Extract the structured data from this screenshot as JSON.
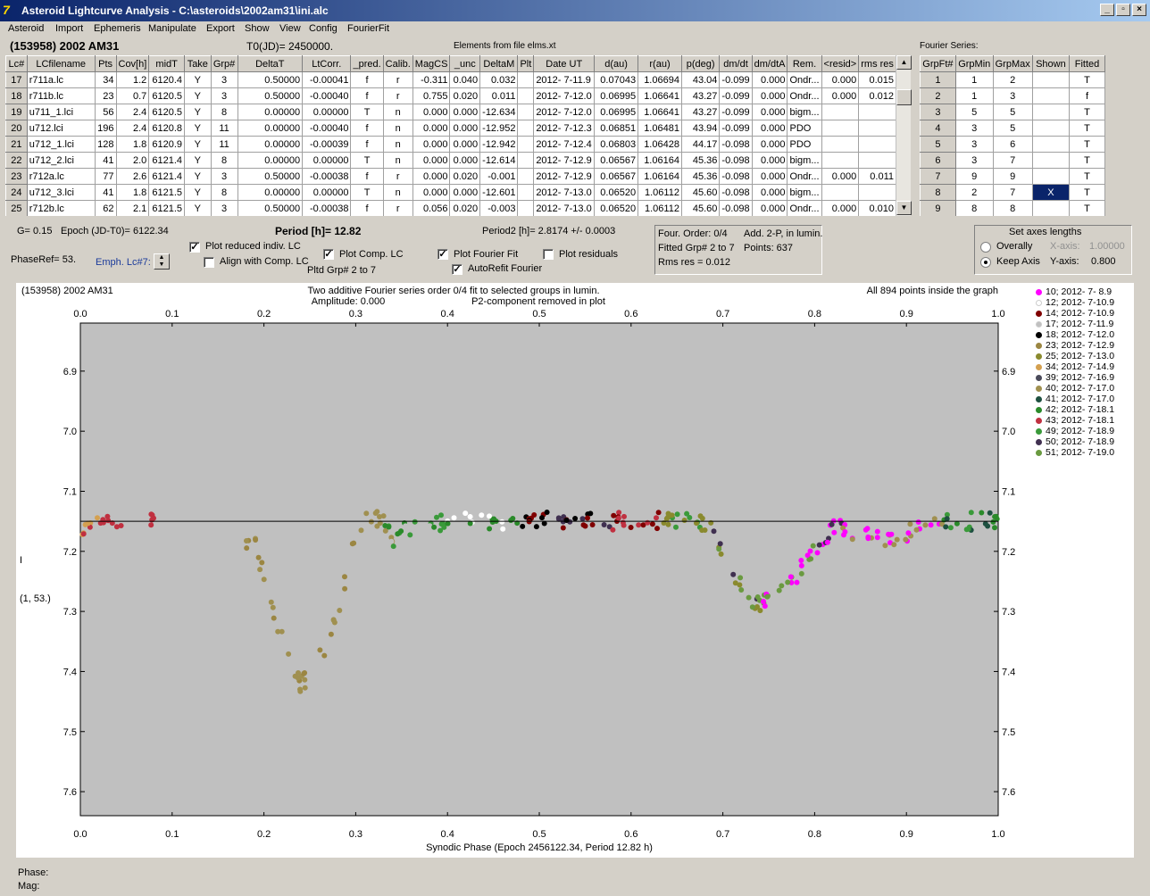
{
  "window": {
    "title": "Asteroid Lightcurve Analysis - C:\\asteroids\\2002am31\\ini.alc"
  },
  "menu": [
    "Asteroid",
    "Import",
    "Ephemeris",
    "Manipulate",
    "Export",
    "Show",
    "View",
    "Config",
    "FourierFit"
  ],
  "header": {
    "object": "(153958) 2002 AM31",
    "t0": "T0(JD)= 2450000.",
    "elements": "Elements from file elms.xt",
    "fourier_series": "Fourier Series:"
  },
  "lc_table": {
    "columns": [
      "Lc#",
      "LCfilename",
      "Pts",
      "Cov[h]",
      "midT",
      "Take",
      "Grp#",
      "DeltaT",
      "LtCorr.",
      "_pred.",
      "Calib.",
      "MagCS",
      "_unc",
      "DeltaM",
      "Plt",
      "Date UT",
      "d(au)",
      "r(au)",
      "p(deg)",
      "dm/dt",
      "dm/dtA",
      "Rem.",
      "<resid>",
      "rms res"
    ],
    "rows": [
      [
        "17",
        "r711a.lc",
        "34",
        "1.2",
        "6120.4",
        "Y",
        "3",
        "0.50000",
        "-0.00041",
        "f",
        "r",
        "-0.311",
        "0.040",
        "0.032",
        "",
        "2012- 7-11.9",
        "0.07043",
        "1.06694",
        "43.04",
        "-0.099",
        "0.000",
        "Ondr...",
        "0.000",
        "0.015"
      ],
      [
        "18",
        "r711b.lc",
        "23",
        "0.7",
        "6120.5",
        "Y",
        "3",
        "0.50000",
        "-0.00040",
        "f",
        "r",
        "0.755",
        "0.020",
        "0.011",
        "",
        "2012- 7-12.0",
        "0.06995",
        "1.06641",
        "43.27",
        "-0.099",
        "0.000",
        "Ondr...",
        "0.000",
        "0.012"
      ],
      [
        "19",
        "u711_1.lci",
        "56",
        "2.4",
        "6120.5",
        "Y",
        "8",
        "0.00000",
        "0.00000",
        "T",
        "n",
        "0.000",
        "0.000",
        "-12.634",
        "",
        "2012- 7-12.0",
        "0.06995",
        "1.06641",
        "43.27",
        "-0.099",
        "0.000",
        "bigm...",
        "",
        ""
      ],
      [
        "20",
        "u712.lci",
        "196",
        "2.4",
        "6120.8",
        "Y",
        "11",
        "0.00000",
        "-0.00040",
        "f",
        "n",
        "0.000",
        "0.000",
        "-12.952",
        "",
        "2012- 7-12.3",
        "0.06851",
        "1.06481",
        "43.94",
        "-0.099",
        "0.000",
        "PDO",
        "",
        ""
      ],
      [
        "21",
        "u712_1.lci",
        "128",
        "1.8",
        "6120.9",
        "Y",
        "11",
        "0.00000",
        "-0.00039",
        "f",
        "n",
        "0.000",
        "0.000",
        "-12.942",
        "",
        "2012- 7-12.4",
        "0.06803",
        "1.06428",
        "44.17",
        "-0.098",
        "0.000",
        "PDO",
        "",
        ""
      ],
      [
        "22",
        "u712_2.lci",
        "41",
        "2.0",
        "6121.4",
        "Y",
        "8",
        "0.00000",
        "0.00000",
        "T",
        "n",
        "0.000",
        "0.000",
        "-12.614",
        "",
        "2012- 7-12.9",
        "0.06567",
        "1.06164",
        "45.36",
        "-0.098",
        "0.000",
        "bigm...",
        "",
        ""
      ],
      [
        "23",
        "r712a.lc",
        "77",
        "2.6",
        "6121.4",
        "Y",
        "3",
        "0.50000",
        "-0.00038",
        "f",
        "r",
        "0.000",
        "0.020",
        "-0.001",
        "",
        "2012- 7-12.9",
        "0.06567",
        "1.06164",
        "45.36",
        "-0.098",
        "0.000",
        "Ondr...",
        "0.000",
        "0.011"
      ],
      [
        "24",
        "u712_3.lci",
        "41",
        "1.8",
        "6121.5",
        "Y",
        "8",
        "0.00000",
        "0.00000",
        "T",
        "n",
        "0.000",
        "0.000",
        "-12.601",
        "",
        "2012- 7-13.0",
        "0.06520",
        "1.06112",
        "45.60",
        "-0.098",
        "0.000",
        "bigm...",
        "",
        ""
      ],
      [
        "25",
        "r712b.lc",
        "62",
        "2.1",
        "6121.5",
        "Y",
        "3",
        "0.50000",
        "-0.00038",
        "f",
        "r",
        "0.056",
        "0.020",
        "-0.003",
        "",
        "2012- 7-13.0",
        "0.06520",
        "1.06112",
        "45.60",
        "-0.098",
        "0.000",
        "Ondr...",
        "0.000",
        "0.010"
      ]
    ]
  },
  "fourier_table": {
    "columns": [
      "GrpFt#",
      "GrpMin",
      "GrpMax",
      "Shown",
      "Fitted"
    ],
    "rows": [
      [
        "1",
        "1",
        "2",
        "",
        "T"
      ],
      [
        "2",
        "1",
        "3",
        "",
        "f"
      ],
      [
        "3",
        "5",
        "5",
        "",
        "T"
      ],
      [
        "4",
        "3",
        "5",
        "",
        "T"
      ],
      [
        "5",
        "3",
        "6",
        "",
        "T"
      ],
      [
        "6",
        "3",
        "7",
        "",
        "T"
      ],
      [
        "7",
        "9",
        "9",
        "",
        "T"
      ],
      [
        "8",
        "2",
        "7",
        "X",
        "T"
      ],
      [
        "9",
        "8",
        "8",
        "",
        "T"
      ]
    ]
  },
  "controls": {
    "g": "G= 0.15",
    "epoch": "Epoch (JD-T0)= 6122.34",
    "period": "Period [h]= 12.82",
    "period2": "Period2 [h]= 2.8174 +/- 0.0003",
    "phaseref": "PhaseRef= 53.",
    "emph": "Emph. Lc#7:",
    "cb_reduced": "Plot reduced indiv. LC",
    "cb_align": "Align with Comp. LC",
    "cb_comp": "Plot Comp. LC",
    "pltd_grp": "Pltd Grp#  2   to   7",
    "cb_fourier": "Plot Fourier Fit",
    "cb_autorefit": "AutoRefit Fourier",
    "cb_resid": "Plot residuals",
    "four_order": "Four. Order:  0/4",
    "add2p": "Add. 2-P, in lumin.",
    "fitted_grp": "Fitted Grp# 2 to 7",
    "points": "Points: 637",
    "rms": "Rms res     = 0.012",
    "axes_title": "Set axes lengths",
    "overally": "Overally",
    "keep_axis": "Keep Axis",
    "xaxis_label": "X-axis:",
    "xaxis_val": "1.00000",
    "yaxis_label": "Y-axis:",
    "yaxis_val": "0.800"
  },
  "chart_data": {
    "type": "scatter",
    "corner_left": "(153958) 2002 AM31",
    "title": "Two additive Fourier series order 0/4 fit to selected groups in lumin.",
    "subtitle1": "Amplitude: 0.000",
    "subtitle2": "P2-component removed in plot",
    "corner_right": "All 894 points inside the graph",
    "xlabel": "Synodic Phase (Epoch 2456122.34, Period 12.82 h)",
    "ylabel_line1": "I",
    "ylabel_line2": "(1, 53.)",
    "xlim": [
      0.0,
      1.0
    ],
    "ylim": [
      7.64,
      6.82
    ],
    "xticks": [
      "0.0",
      "0.1",
      "0.2",
      "0.3",
      "0.4",
      "0.5",
      "0.6",
      "0.7",
      "0.8",
      "0.9",
      "1.0"
    ],
    "yticks": [
      "6.9",
      "7.0",
      "7.1",
      "7.2",
      "7.3",
      "7.4",
      "7.5",
      "7.6"
    ],
    "fit_line_y": 7.15,
    "series": [
      {
        "name": "10; 2012- 7- 8.9",
        "color": "#ff00ff"
      },
      {
        "name": "12; 2012- 7-10.9",
        "color": "#ffffff"
      },
      {
        "name": "14; 2012- 7-10.9",
        "color": "#800000"
      },
      {
        "name": "17; 2012- 7-11.9",
        "color": "#c0c0c0"
      },
      {
        "name": "18; 2012- 7-12.0",
        "color": "#000000"
      },
      {
        "name": "23; 2012- 7-12.9",
        "color": "#9b8642"
      },
      {
        "name": "25; 2012- 7-13.0",
        "color": "#8a8a2e"
      },
      {
        "name": "34; 2012- 7-14.9",
        "color": "#d4a050"
      },
      {
        "name": "39; 2012- 7-16.9",
        "color": "#4a4a5a"
      },
      {
        "name": "40; 2012- 7-17.0",
        "color": "#a09050"
      },
      {
        "name": "41; 2012- 7-17.0",
        "color": "#1e5040"
      },
      {
        "name": "42; 2012- 7-18.1",
        "color": "#2a8a2a"
      },
      {
        "name": "43; 2012- 7-18.1",
        "color": "#c03040"
      },
      {
        "name": "49; 2012- 7-18.9",
        "color": "#3a9a3a"
      },
      {
        "name": "50; 2012- 7-18.9",
        "color": "#403050"
      },
      {
        "name": "51; 2012- 7-19.0",
        "color": "#6a9a40"
      }
    ],
    "points_curve": [
      [
        0.0,
        7.16
      ],
      [
        0.02,
        7.15
      ],
      [
        0.04,
        7.16
      ],
      [
        0.08,
        7.15
      ],
      [
        0.19,
        7.19
      ],
      [
        0.2,
        7.24
      ],
      [
        0.21,
        7.3
      ],
      [
        0.22,
        7.35
      ],
      [
        0.23,
        7.4
      ],
      [
        0.24,
        7.42
      ],
      [
        0.25,
        7.41
      ],
      [
        0.26,
        7.38
      ],
      [
        0.27,
        7.35
      ],
      [
        0.28,
        7.3
      ],
      [
        0.29,
        7.24
      ],
      [
        0.3,
        7.17
      ],
      [
        0.31,
        7.14
      ],
      [
        0.33,
        7.15
      ],
      [
        0.34,
        7.18
      ],
      [
        0.36,
        7.16
      ],
      [
        0.4,
        7.15
      ],
      [
        0.45,
        7.15
      ],
      [
        0.5,
        7.15
      ],
      [
        0.55,
        7.15
      ],
      [
        0.6,
        7.15
      ],
      [
        0.65,
        7.15
      ],
      [
        0.68,
        7.15
      ],
      [
        0.7,
        7.2
      ],
      [
        0.72,
        7.26
      ],
      [
        0.74,
        7.29
      ],
      [
        0.76,
        7.27
      ],
      [
        0.78,
        7.24
      ],
      [
        0.8,
        7.2
      ],
      [
        0.82,
        7.16
      ],
      [
        0.85,
        7.17
      ],
      [
        0.88,
        7.18
      ],
      [
        0.92,
        7.16
      ],
      [
        0.96,
        7.15
      ],
      [
        1.0,
        7.15
      ]
    ]
  },
  "status": {
    "phase": "Phase:",
    "mag": "Mag:"
  }
}
